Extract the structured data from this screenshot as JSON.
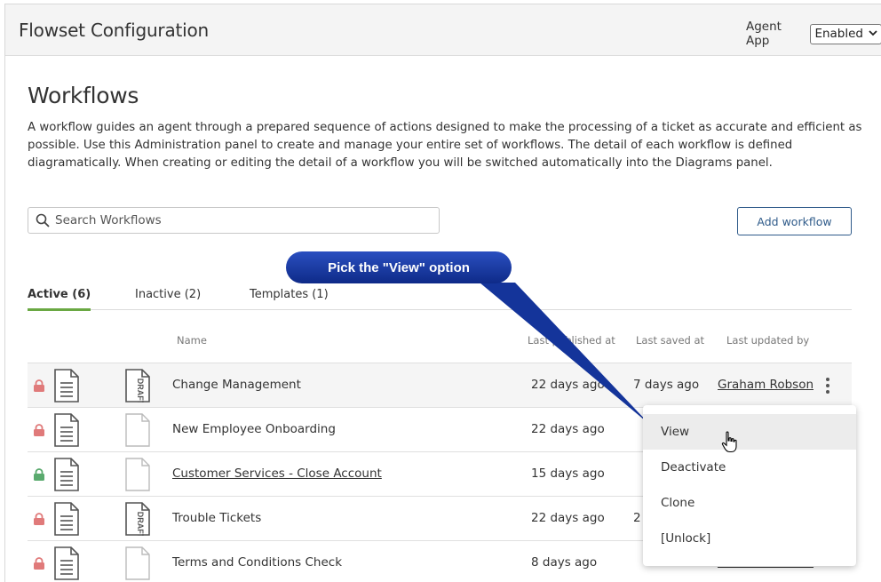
{
  "header": {
    "title": "Flowset Configuration",
    "agent_app_label": "Agent App",
    "agent_app_value": "Enabled"
  },
  "main": {
    "heading": "Workflows",
    "description": "A workflow guides an agent through a prepared sequence of actions designed to make the processing of a ticket as accurate and efficient as possible. Use this Administration panel to create and manage your entire set of workflows. The detail of each workflow is defined diagramatically. When creating or editing the detail of a workflow you will be switched automatically into the Diagrams panel.",
    "search_placeholder": "Search Workflows",
    "add_button": "Add workflow"
  },
  "tabs": [
    {
      "label": "Active (6)",
      "active": true
    },
    {
      "label": "Inactive (2)",
      "active": false
    },
    {
      "label": "Templates (1)",
      "active": false
    }
  ],
  "columns": {
    "name": "Name",
    "published": "Last published at",
    "saved": "Last saved at",
    "updated": "Last updated by"
  },
  "rows": [
    {
      "name": "Change Management",
      "published": "22 days ago",
      "saved": "7 days ago",
      "updated": "Graham Robson",
      "lock_color": "#e07a7a",
      "draft": true
    },
    {
      "name": "New Employee Onboarding",
      "published": "22 days ago",
      "saved": "",
      "updated": "",
      "lock_color": "#e07a7a",
      "draft": false
    },
    {
      "name": "Customer Services - Close Account",
      "published": "15 days ago",
      "saved": "",
      "updated": "",
      "lock_color": "#5aaa6e",
      "draft": false
    },
    {
      "name": "Trouble Tickets",
      "published": "22 days ago",
      "saved": "2",
      "updated": "",
      "lock_color": "#e07a7a",
      "draft": true
    },
    {
      "name": "Terms and Conditions Check",
      "published": "8 days ago",
      "saved": "",
      "updated": "Graham Robson",
      "lock_color": "#e07a7a",
      "draft": false
    }
  ],
  "menu": {
    "items": [
      "View",
      "Deactivate",
      "Clone",
      "[Unlock]"
    ]
  },
  "callout": {
    "text": "Pick the \"View\" option",
    "color": "#14349a"
  }
}
